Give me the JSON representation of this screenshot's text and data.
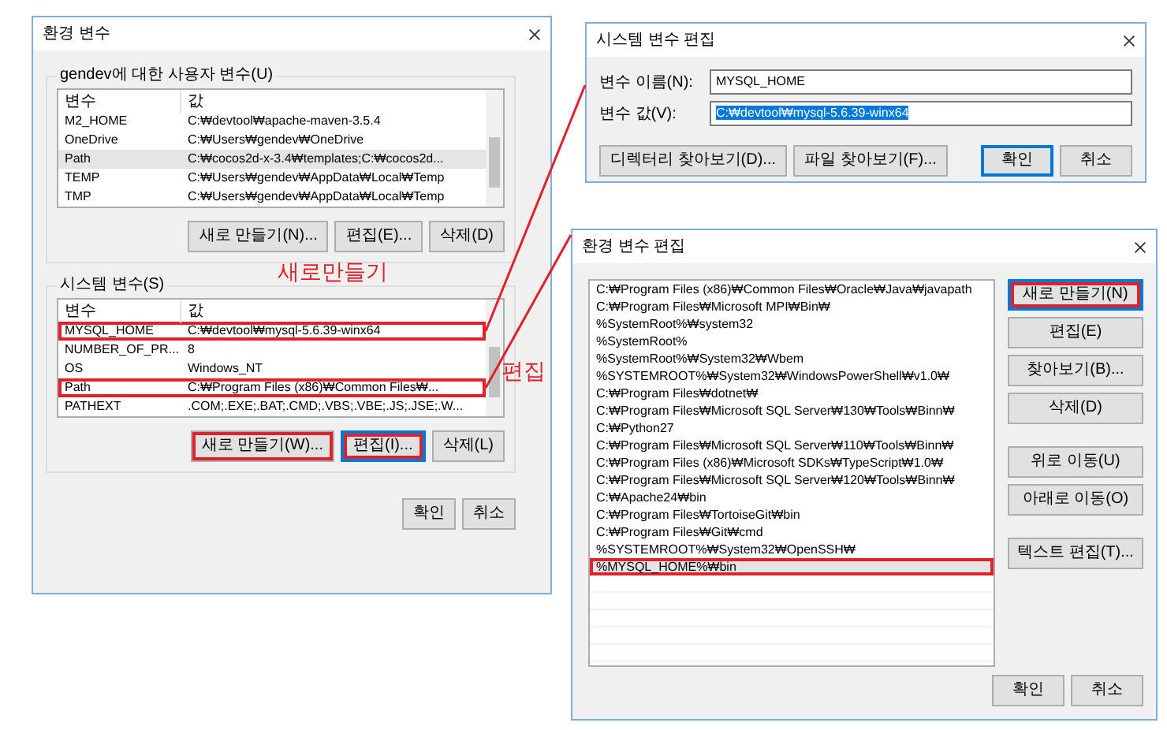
{
  "env_dialog": {
    "title": "환경 변수",
    "user_vars": {
      "label": "gendev에 대한 사용자 변수(U)",
      "columns": [
        "변수",
        "값"
      ],
      "rows": [
        {
          "name": "M2_HOME",
          "value": "C:₩devtool₩apache-maven-3.5.4",
          "selected": false,
          "highlighted": false
        },
        {
          "name": "OneDrive",
          "value": "C:₩Users₩gendev₩OneDrive",
          "selected": false,
          "highlighted": false
        },
        {
          "name": "Path",
          "value": "C:₩cocos2d-x-3.4₩templates;C:₩cocos2d...",
          "selected": true,
          "highlighted": false
        },
        {
          "name": "TEMP",
          "value": "C:₩Users₩gendev₩AppData₩Local₩Temp",
          "selected": false,
          "highlighted": false
        },
        {
          "name": "TMP",
          "value": "C:₩Users₩gendev₩AppData₩Local₩Temp",
          "selected": false,
          "highlighted": false
        }
      ],
      "buttons": [
        {
          "label": "새로 만들기(N)...",
          "focused": false,
          "highlighted": false
        },
        {
          "label": "편집(E)...",
          "focused": false,
          "highlighted": false
        },
        {
          "label": "삭제(D)",
          "focused": false,
          "highlighted": false
        }
      ]
    },
    "system_vars": {
      "label": "시스템 변수(S)",
      "columns": [
        "변수",
        "값"
      ],
      "rows": [
        {
          "name": "MYSQL_HOME",
          "value": "C:₩devtool₩mysql-5.6.39-winx64",
          "selected": false,
          "highlighted": true
        },
        {
          "name": "NUMBER_OF_PR...",
          "value": "8",
          "selected": false,
          "highlighted": false
        },
        {
          "name": "OS",
          "value": "Windows_NT",
          "selected": false,
          "highlighted": false
        },
        {
          "name": "Path",
          "value": "C:₩Program Files (x86)₩Common Files₩...",
          "selected": false,
          "highlighted": true
        },
        {
          "name": "PATHEXT",
          "value": ".COM;.EXE;.BAT;.CMD;.VBS;.VBE;.JS;.JSE;.W...",
          "selected": false,
          "highlighted": false
        }
      ],
      "buttons": [
        {
          "label": "새로 만들기(W)...",
          "focused": false,
          "highlighted": true
        },
        {
          "label": "편집(I)...",
          "focused": true,
          "highlighted": true
        },
        {
          "label": "삭제(L)",
          "focused": false,
          "highlighted": false
        }
      ]
    },
    "buttons": [
      {
        "label": "확인",
        "focused": false,
        "highlighted": false
      },
      {
        "label": "취소",
        "focused": false,
        "highlighted": false
      }
    ]
  },
  "edit_var_dialog": {
    "title": "시스템 변수 편집",
    "fields": [
      {
        "label": "변수 이름(N):",
        "value": "MYSQL_HOME",
        "selected": false
      },
      {
        "label": "변수 값(V):",
        "value": "C:₩devtool₩mysql-5.6.39-winx64",
        "selected": true
      }
    ],
    "browse_buttons": [
      {
        "label": "디렉터리 찾아보기(D)...",
        "focused": false,
        "highlighted": false
      },
      {
        "label": "파일 찾아보기(F)...",
        "focused": false,
        "highlighted": false
      }
    ],
    "buttons": [
      {
        "label": "확인",
        "focused": true,
        "highlighted": false
      },
      {
        "label": "취소",
        "focused": false,
        "highlighted": false
      }
    ]
  },
  "edit_env_dialog": {
    "title": "환경 변수 편집",
    "items": [
      {
        "text": "C:₩Program Files (x86)₩Common Files₩Oracle₩Java₩javapath",
        "selected": false,
        "highlighted": false
      },
      {
        "text": "C:₩Program Files₩Microsoft MPI₩Bin₩",
        "selected": false,
        "highlighted": false
      },
      {
        "text": "%SystemRoot%₩system32",
        "selected": false,
        "highlighted": false
      },
      {
        "text": "%SystemRoot%",
        "selected": false,
        "highlighted": false
      },
      {
        "text": "%SystemRoot%₩System32₩Wbem",
        "selected": false,
        "highlighted": false
      },
      {
        "text": "%SYSTEMROOT%₩System32₩WindowsPowerShell₩v1.0₩",
        "selected": false,
        "highlighted": false
      },
      {
        "text": "C:₩Program Files₩dotnet₩",
        "selected": false,
        "highlighted": false
      },
      {
        "text": "C:₩Program Files₩Microsoft SQL Server₩130₩Tools₩Binn₩",
        "selected": false,
        "highlighted": false
      },
      {
        "text": "C:₩Python27",
        "selected": false,
        "highlighted": false
      },
      {
        "text": "C:₩Program Files₩Microsoft SQL Server₩110₩Tools₩Binn₩",
        "selected": false,
        "highlighted": false
      },
      {
        "text": "C:₩Program Files (x86)₩Microsoft SDKs₩TypeScript₩1.0₩",
        "selected": false,
        "highlighted": false
      },
      {
        "text": "C:₩Program Files₩Microsoft SQL Server₩120₩Tools₩Binn₩",
        "selected": false,
        "highlighted": false
      },
      {
        "text": "C:₩Apache24₩bin",
        "selected": false,
        "highlighted": false
      },
      {
        "text": "C:₩Program Files₩TortoiseGit₩bin",
        "selected": false,
        "highlighted": false
      },
      {
        "text": "C:₩Program Files₩Git₩cmd",
        "selected": false,
        "highlighted": false
      },
      {
        "text": "%SYSTEMROOT%₩System32₩OpenSSH₩",
        "selected": false,
        "highlighted": false
      },
      {
        "text": "%MYSQL_HOME%₩bin",
        "selected": true,
        "highlighted": true
      }
    ],
    "side_button_groups": [
      [
        {
          "label": "새로 만들기(N)",
          "focused": true,
          "highlighted": true
        },
        {
          "label": "편집(E)",
          "focused": false,
          "highlighted": false
        },
        {
          "label": "찾아보기(B)...",
          "focused": false,
          "highlighted": false
        },
        {
          "label": "삭제(D)",
          "focused": false,
          "highlighted": false
        }
      ],
      [
        {
          "label": "위로 이동(U)",
          "focused": false,
          "highlighted": false
        },
        {
          "label": "아래로 이동(O)",
          "focused": false,
          "highlighted": false
        }
      ],
      [
        {
          "label": "텍스트 편집(T)...",
          "focused": false,
          "highlighted": false
        }
      ]
    ],
    "buttons": [
      {
        "label": "확인",
        "focused": false,
        "highlighted": false
      },
      {
        "label": "취소",
        "focused": false,
        "highlighted": false
      }
    ]
  },
  "annotations": [
    {
      "text": "새로만들기"
    },
    {
      "text": "편집"
    }
  ]
}
